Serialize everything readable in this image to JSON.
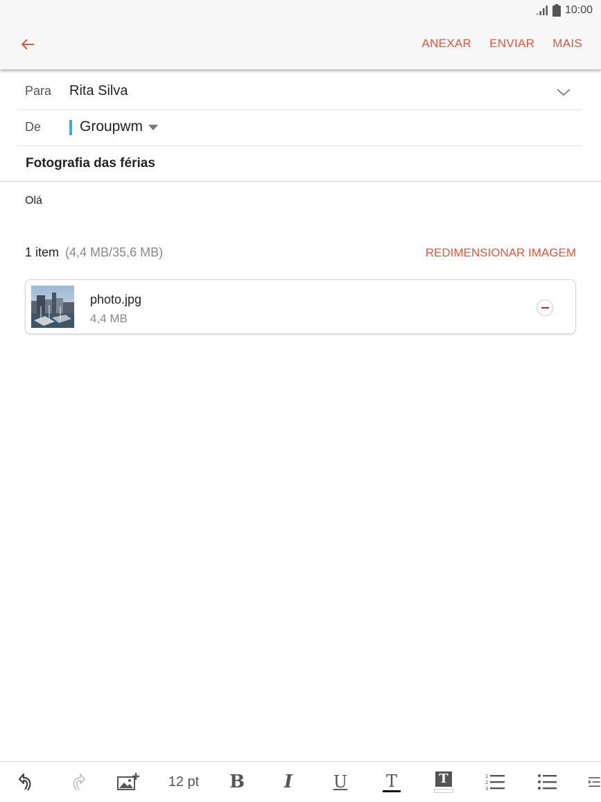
{
  "status_bar": {
    "time": "10:00"
  },
  "app_bar": {
    "actions": [
      {
        "label": "ANEXAR"
      },
      {
        "label": "ENVIAR"
      },
      {
        "label": "MAIS"
      }
    ]
  },
  "to": {
    "label": "Para",
    "value": "Rita Silva"
  },
  "from": {
    "label": "De",
    "account": "Groupwm"
  },
  "subject": "Fotografia das férias",
  "body": "Olá",
  "attachments": {
    "count_label": "1 item",
    "size_label": "(4,4 MB/35,6 MB)",
    "resize_label": "REDIMENSIONAR IMAGEM",
    "items": [
      {
        "name": "photo.jpg",
        "size": "4,4 MB"
      }
    ]
  },
  "toolbar": {
    "font_size": "12 pt",
    "bold": "B",
    "italic": "I",
    "underline": "U",
    "text_color": "T",
    "highlight": "T",
    "icons": [
      "undo-icon",
      "redo-icon",
      "insert-image-icon",
      "bold-icon",
      "italic-icon",
      "underline-icon",
      "text-color-icon",
      "background-color-icon",
      "numbered-list-icon",
      "bullet-list-icon",
      "indent-icon"
    ]
  },
  "colors": {
    "accent": "#e0583e",
    "account_bar": "#3fa9e0",
    "remove": "#c0262c"
  }
}
